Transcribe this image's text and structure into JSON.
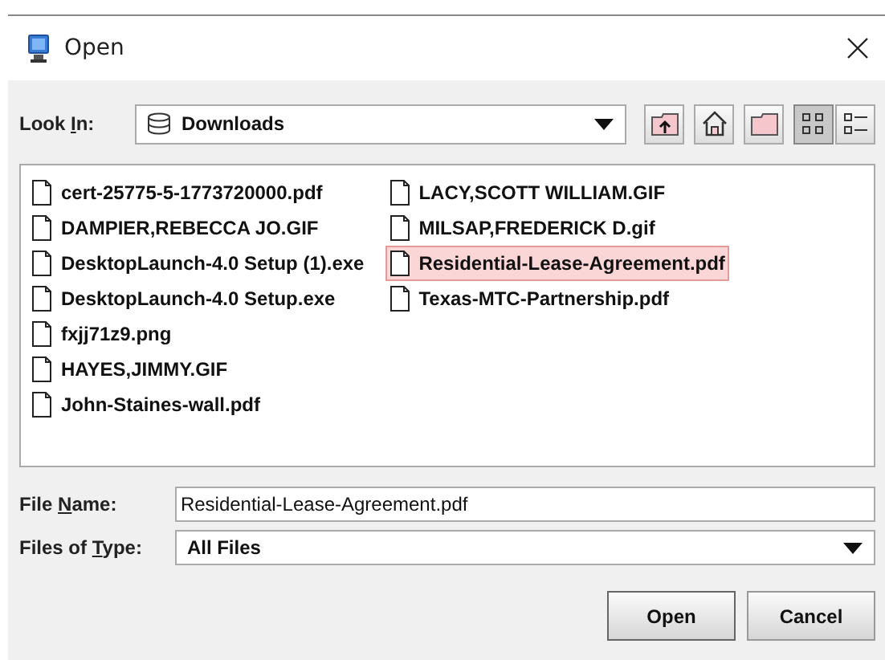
{
  "window": {
    "title": "Open"
  },
  "look_in": {
    "label": {
      "before": "Look ",
      "mnemonic": "I",
      "after": "n:"
    },
    "value": "Downloads"
  },
  "view_buttons": [
    {
      "kind": "list",
      "selected": true
    },
    {
      "kind": "details",
      "selected": false
    }
  ],
  "files": [
    {
      "name": "cert-25775-5-1773720000.pdf",
      "selected": false
    },
    {
      "name": "DAMPIER,REBECCA JO.GIF",
      "selected": false
    },
    {
      "name": "DesktopLaunch-4.0 Setup (1).exe",
      "selected": false
    },
    {
      "name": "DesktopLaunch-4.0 Setup.exe",
      "selected": false
    },
    {
      "name": "fxjj71z9.png",
      "selected": false
    },
    {
      "name": "HAYES,JIMMY.GIF",
      "selected": false
    },
    {
      "name": "John-Staines-wall.pdf",
      "selected": false
    },
    {
      "name": "LACY,SCOTT WILLIAM.GIF",
      "selected": false
    },
    {
      "name": "MILSAP,FREDERICK D.gif",
      "selected": false
    },
    {
      "name": "Residential-Lease-Agreement.pdf",
      "selected": true
    },
    {
      "name": "Texas-MTC-Partnership.pdf",
      "selected": false
    }
  ],
  "file_name": {
    "label": {
      "before": "File ",
      "mnemonic": "N",
      "after": "ame:"
    },
    "value": "Residential-Lease-Agreement.pdf"
  },
  "files_of_type": {
    "label": {
      "before": "Files of ",
      "mnemonic": "T",
      "after": "ype:"
    },
    "value": "All Files"
  },
  "buttons": [
    "Open",
    "Cancel"
  ]
}
